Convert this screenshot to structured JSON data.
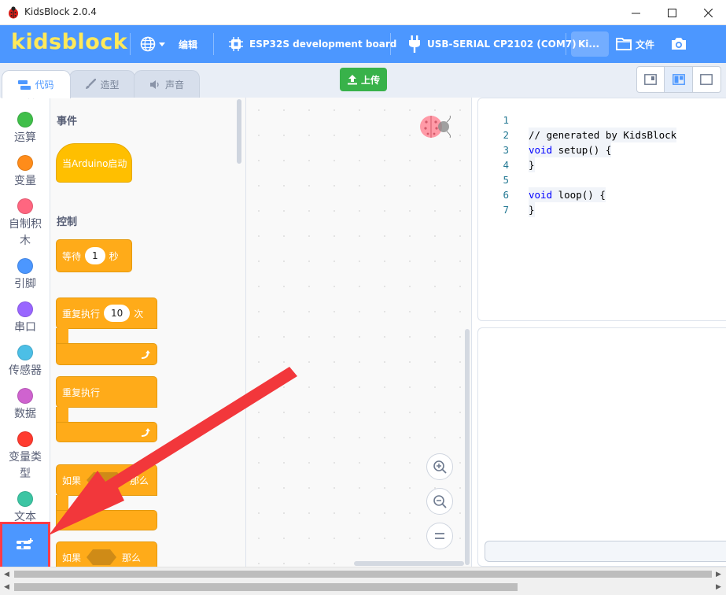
{
  "app": {
    "title": "KidsBlock 2.0.4",
    "logo": "kidsblock"
  },
  "menubar": {
    "language_icon": "globe-icon",
    "edit_label": "编辑",
    "board_label": "ESP32S development board",
    "port_label": "USB-SERIAL CP2102 (COM7)",
    "ki_label": "Ki...",
    "file_label": "文件",
    "colors": {
      "bg": "#4c97ff",
      "logo": "#ffe95a"
    }
  },
  "tabs": [
    {
      "label": "代码",
      "active": true
    },
    {
      "label": "造型",
      "active": false
    },
    {
      "label": "声音",
      "active": false
    }
  ],
  "toolbar": {
    "upload_label": "上传",
    "upload_color": "#38b24a"
  },
  "categories": [
    {
      "label": "控制",
      "color": "#ffab19"
    },
    {
      "label": "运算",
      "color": "#40bf4a"
    },
    {
      "label": "变量",
      "color": "#ff8c1a"
    },
    {
      "label": "自制积木",
      "color": "#ff6680"
    },
    {
      "label": "引脚",
      "color": "#4c97ff"
    },
    {
      "label": "串口",
      "color": "#9966ff"
    },
    {
      "label": "传感器",
      "color": "#4cbfe6"
    },
    {
      "label": "数据",
      "color": "#cf63cf"
    },
    {
      "label": "变量类型",
      "color": "#ff3b2f"
    },
    {
      "label": "文本",
      "color": "#3cc5a3"
    }
  ],
  "palette": {
    "events_header": "事件",
    "hat_block": "当Arduino启动",
    "control_header": "控制",
    "wait_block": {
      "prefix": "等待",
      "value": "1",
      "suffix": "秒"
    },
    "repeat_block": {
      "prefix": "重复执行",
      "value": "10",
      "suffix": "次"
    },
    "forever_block": "重复执行",
    "if_block": {
      "prefix": "如果",
      "suffix": "那么"
    },
    "if_block2": {
      "prefix": "如果",
      "suffix": "那么"
    }
  },
  "code": {
    "lines": [
      {
        "n": "1",
        "text": "// generated by KidsBlock"
      },
      {
        "n": "2",
        "text": "void setup() {"
      },
      {
        "n": "3",
        "text": "}"
      },
      {
        "n": "4",
        "text": ""
      },
      {
        "n": "5",
        "text": "void loop() {"
      },
      {
        "n": "6",
        "text": "}"
      },
      {
        "n": "7",
        "text": ""
      }
    ]
  }
}
